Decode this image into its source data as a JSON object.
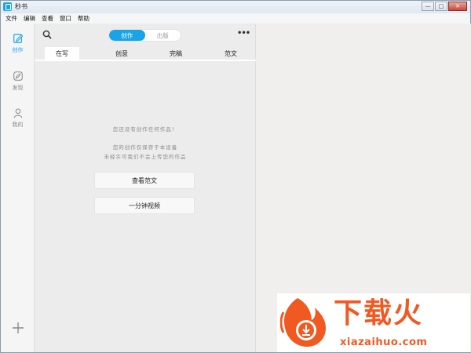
{
  "window": {
    "title": "秒书",
    "controls": [
      "—",
      "□",
      "✕"
    ]
  },
  "menu": [
    "文件",
    "编辑",
    "查看",
    "窗口",
    "帮助"
  ],
  "nav": {
    "items": [
      {
        "label": "创作",
        "icon": "edit-icon",
        "active": true
      },
      {
        "label": "发现",
        "icon": "compass-icon",
        "active": false
      },
      {
        "label": "我的",
        "icon": "user-icon",
        "active": false
      }
    ],
    "add_icon": "plus-icon"
  },
  "panel": {
    "segment": {
      "options": [
        "创作",
        "出版"
      ],
      "selected": "创作"
    },
    "more": "•••",
    "tabs": [
      "在写",
      "创意",
      "完稿",
      "范文"
    ],
    "active_tab": "在写",
    "empty_message": [
      "您还没有创作任何作品！",
      "您的创作仅保存于本设备",
      "未经许可我们不会上传您的作品"
    ],
    "buttons": [
      "查看范文",
      "一分钟视频"
    ]
  },
  "watermark": {
    "brand": "下载火",
    "domain": "xiazaihuo.com"
  },
  "colors": {
    "accent": "#1aa4e8",
    "brand_orange": "#f05a22"
  }
}
